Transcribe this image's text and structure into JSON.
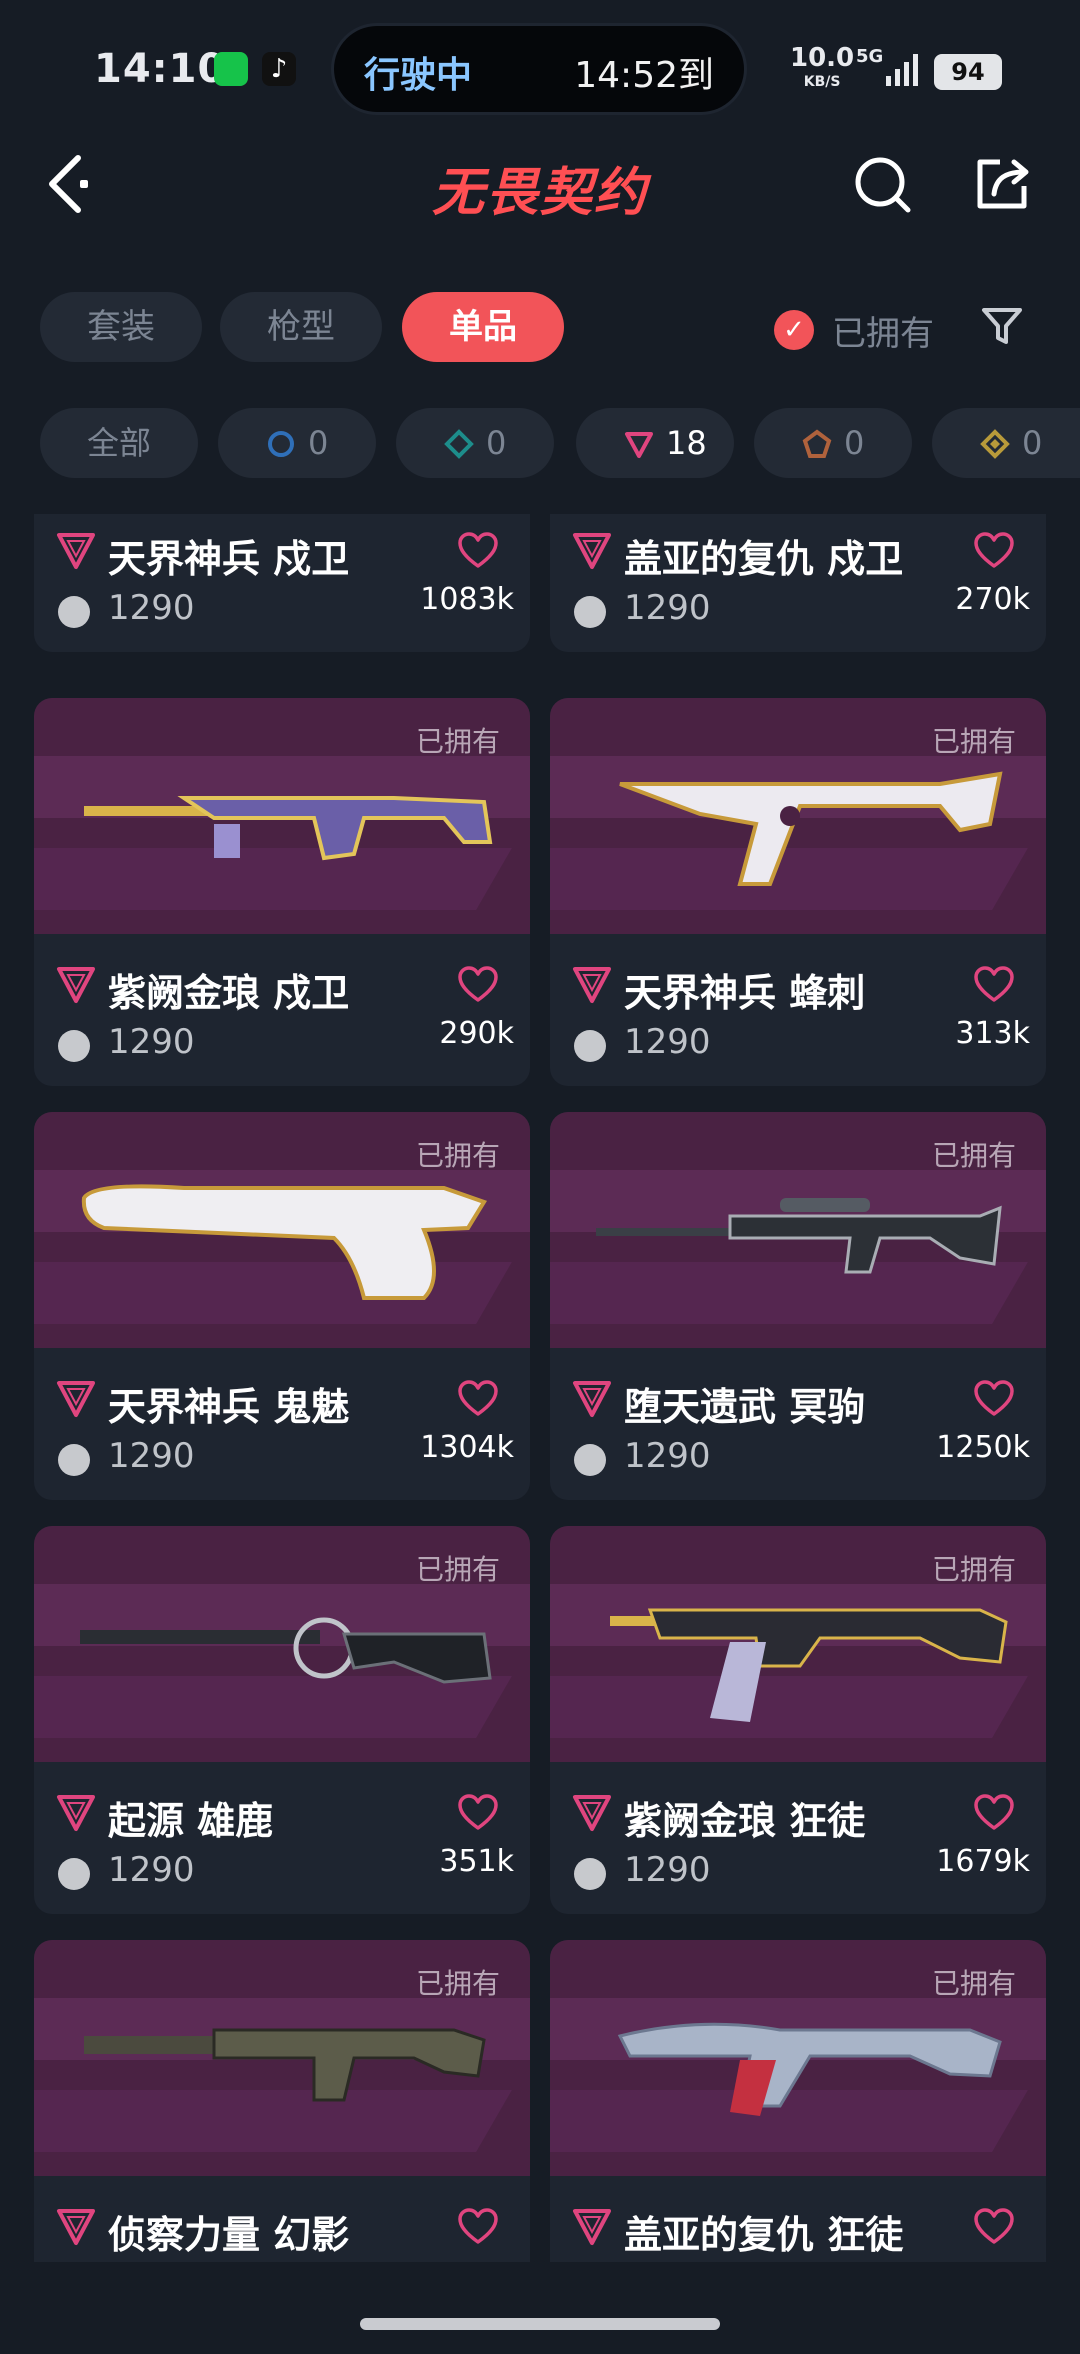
{
  "status_bar": {
    "time": "14:10",
    "island_left": "行驶中",
    "island_right": "14:52到",
    "net_speed": "10.0",
    "net_unit": "KB/S",
    "network": "5G",
    "battery": "94"
  },
  "header": {
    "title": "无畏契约"
  },
  "tabs": [
    {
      "label": "套装"
    },
    {
      "label": "枪型"
    },
    {
      "label": "单品"
    }
  ],
  "owned_filter": {
    "label": "已拥有"
  },
  "rarity_chips": [
    {
      "label": "全部"
    },
    {
      "count": "0",
      "color": "#2f6fb8"
    },
    {
      "count": "0",
      "color": "#1d8d8b"
    },
    {
      "count": "18",
      "color": "#e0457f"
    },
    {
      "count": "0",
      "color": "#b0623c"
    },
    {
      "count": "0",
      "color": "#b89a3a"
    }
  ],
  "items": [
    {
      "name": "天界神兵 戍卫",
      "price": "1290",
      "likes": "1083k",
      "owned": ""
    },
    {
      "name": "盖亚的复仇 戍卫",
      "price": "1290",
      "likes": "270k",
      "owned": ""
    },
    {
      "name": "紫阙金琅 戍卫",
      "price": "1290",
      "likes": "290k",
      "owned": "已拥有"
    },
    {
      "name": "天界神兵 蜂刺",
      "price": "1290",
      "likes": "313k",
      "owned": "已拥有"
    },
    {
      "name": "天界神兵 鬼魅",
      "price": "1290",
      "likes": "1304k",
      "owned": "已拥有"
    },
    {
      "name": "堕天遗武 冥驹",
      "price": "1290",
      "likes": "1250k",
      "owned": "已拥有"
    },
    {
      "name": "起源 雄鹿",
      "price": "1290",
      "likes": "351k",
      "owned": "已拥有"
    },
    {
      "name": "紫阙金琅 狂徒",
      "price": "1290",
      "likes": "1679k",
      "owned": "已拥有"
    },
    {
      "name": "侦察力量 幻影",
      "price": "",
      "likes": "",
      "owned": "已拥有"
    },
    {
      "name": "盖亚的复仇 狂徒",
      "price": "",
      "likes": "",
      "owned": "已拥有"
    }
  ],
  "colors": {
    "accent": "#f25459",
    "rarity_pink": "#e0457f",
    "card_bg": "#1e2530",
    "image_bg": "#4a2243"
  }
}
